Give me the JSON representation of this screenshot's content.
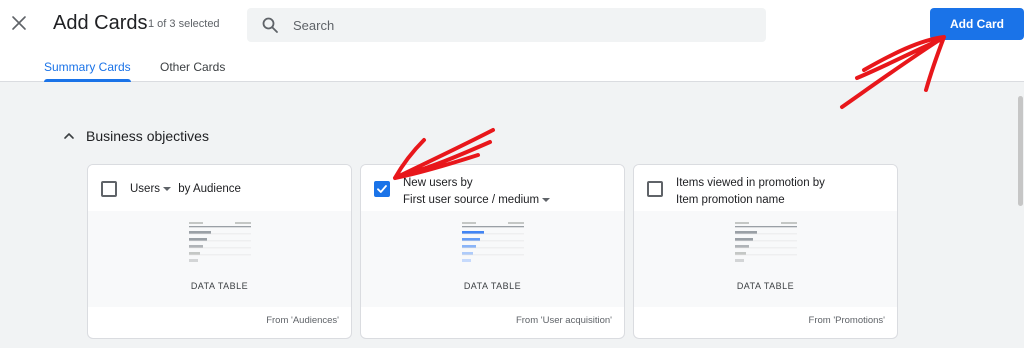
{
  "header": {
    "title": "Add Cards",
    "selected_count": "1 of 3 selected",
    "search_placeholder": "Search",
    "add_button": "Add Card"
  },
  "tabs": [
    {
      "label": "Summary Cards",
      "active": true
    },
    {
      "label": "Other Cards",
      "active": false
    }
  ],
  "section": {
    "label": "Business objectives",
    "expanded": true
  },
  "cards": [
    {
      "checked": false,
      "metric": "Users",
      "connector": "by Audience",
      "type": "DATA TABLE",
      "source": "From 'Audiences'"
    },
    {
      "checked": true,
      "line1": "New users by",
      "dimension": "First user source / medium",
      "type": "DATA TABLE",
      "source": "From 'User acquisition'"
    },
    {
      "checked": false,
      "line1": "Items viewed in promotion by",
      "line2": "Item promotion name",
      "type": "DATA TABLE",
      "source": "From 'Promotions'"
    }
  ],
  "colors": {
    "accent": "#1a73e8",
    "annotation": "#e8171b",
    "preview_gray": "#9aa0a6",
    "preview_blue": "#4285f4"
  }
}
